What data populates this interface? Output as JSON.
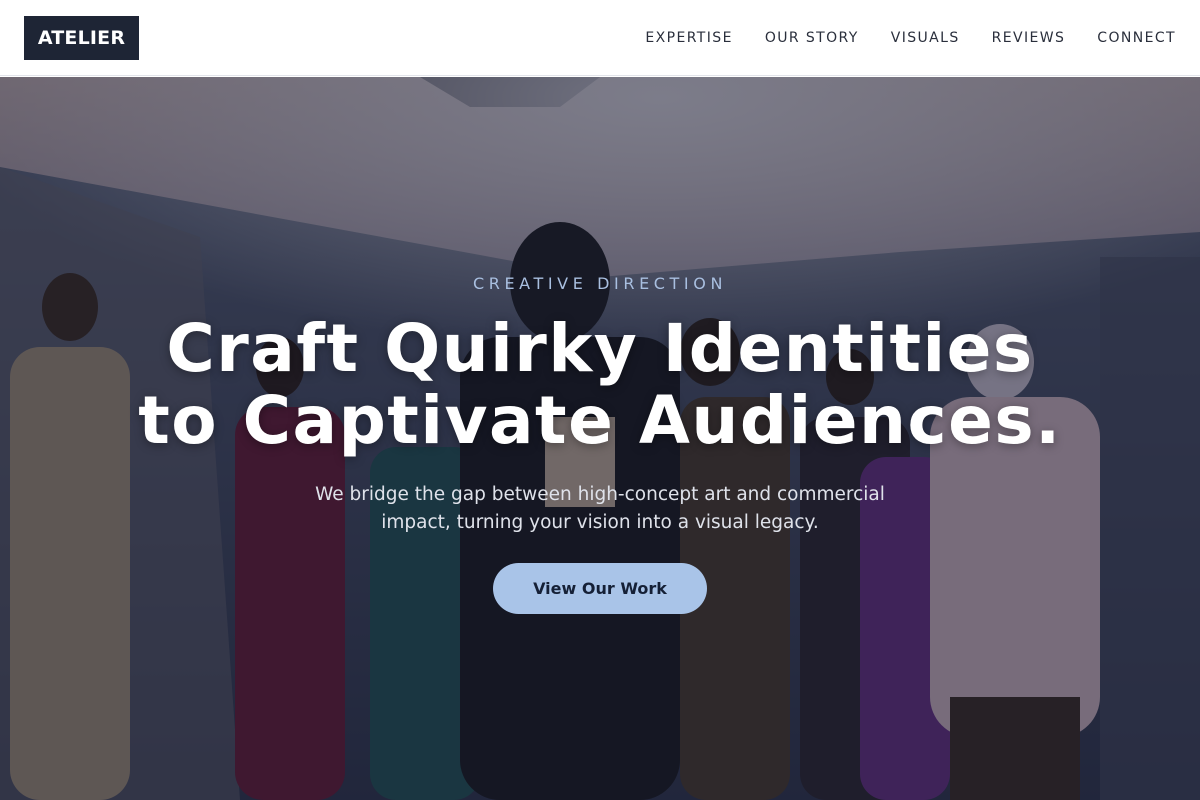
{
  "brand": {
    "logo_text": "ATELIER"
  },
  "nav": {
    "items": [
      {
        "label": "EXPERTISE"
      },
      {
        "label": "OUR STORY"
      },
      {
        "label": "VISUALS"
      },
      {
        "label": "REVIEWS"
      },
      {
        "label": "CONNECT"
      }
    ]
  },
  "hero": {
    "kicker": "CREATIVE DIRECTION",
    "headline_line1": "Craft Quirky Identities",
    "headline_line2": "to Captivate Audiences.",
    "subtitle_line1": "We bridge the gap between high-concept art and commercial",
    "subtitle_line2": "impact, turning your vision into a visual legacy.",
    "cta_label": "View Our Work",
    "background_image": "fashion-group-photo"
  },
  "colors": {
    "logo_bg": "#1e2535",
    "kicker": "#a9bfe0",
    "cta_bg": "#a9c4e8",
    "cta_text": "#152036"
  }
}
